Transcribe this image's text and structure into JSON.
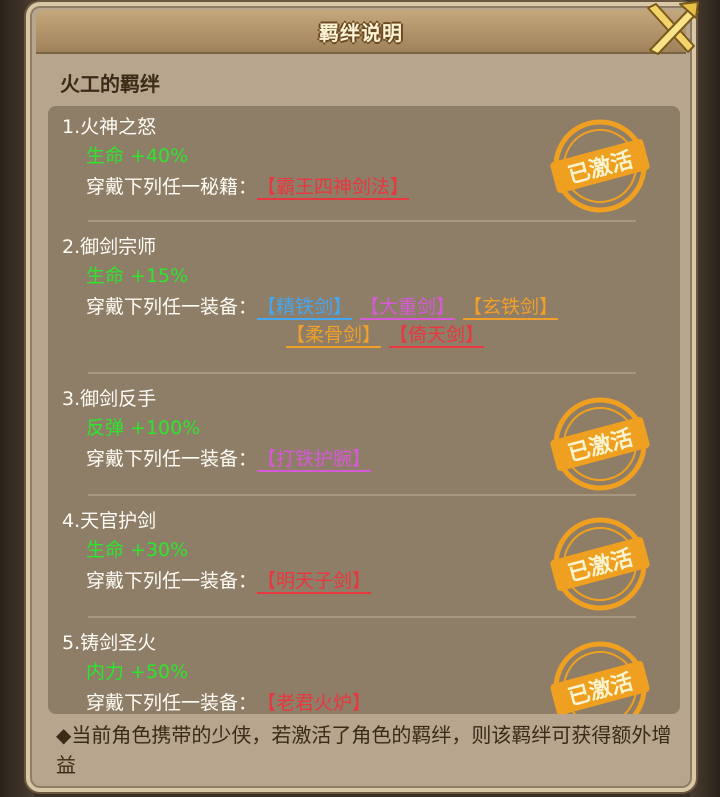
{
  "dialog": {
    "title": "羁绊说明",
    "hero_title": "火工的羁绊",
    "stamp_text": "已激活"
  },
  "bonds": [
    {
      "name": "1.火神之怒",
      "effect": "生命 +40%",
      "requirement": "穿戴下列任一秘籍：",
      "items": [
        {
          "text": "【霸王四神剑法】",
          "color": "#e8373f"
        }
      ],
      "activated": true
    },
    {
      "name": "2.御剑宗师",
      "effect": "生命 +15%",
      "requirement": "穿戴下列任一装备：",
      "items": [
        {
          "text": "【精铁剑】",
          "color": "#46a6f0"
        },
        {
          "text": "【大重剑】",
          "color": "#d65ad6"
        },
        {
          "text": "【玄铁剑】",
          "color": "#f0a02a"
        },
        {
          "text": "【柔骨剑】",
          "color": "#f0a02a"
        },
        {
          "text": "【倚天剑】",
          "color": "#e8373f"
        }
      ],
      "activated": false
    },
    {
      "name": "3.御剑反手",
      "effect": "反弹 +100%",
      "requirement": "穿戴下列任一装备：",
      "items": [
        {
          "text": "【打铁护腕】",
          "color": "#d65ad6"
        }
      ],
      "activated": true
    },
    {
      "name": "4.天官护剑",
      "effect": "生命 +30%",
      "requirement": "穿戴下列任一装备：",
      "items": [
        {
          "text": "【明天子剑】",
          "color": "#e8373f"
        }
      ],
      "activated": true
    },
    {
      "name": "5.铸剑圣火",
      "effect": "内力 +50%",
      "requirement": "穿戴下列任一装备：",
      "items": [
        {
          "text": "【老君火炉】",
          "color": "#e8373f"
        }
      ],
      "activated": true
    }
  ],
  "footer": {
    "note": "◆当前角色携带的少侠，若激活了角色的羁绊，则该羁绊可获得额外增益"
  },
  "colors": {
    "effect_green": "#2ee52e",
    "stamp_orange": "#f0a020"
  }
}
